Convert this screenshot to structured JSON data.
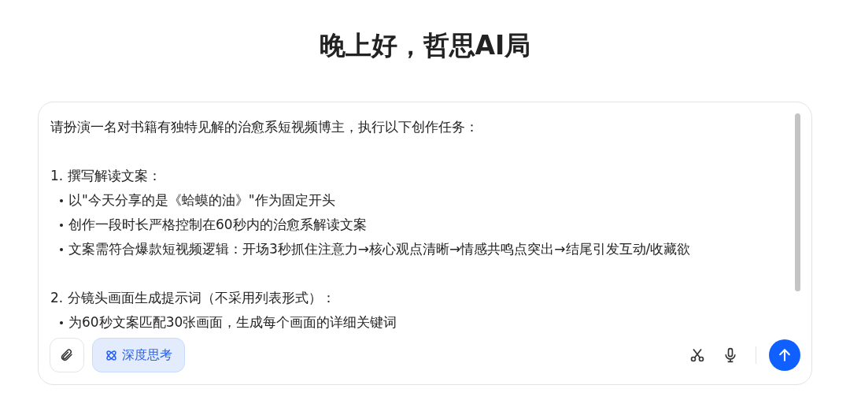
{
  "greeting": "晚上好，哲思AI局",
  "prompt": {
    "lines": [
      {
        "kind": "text",
        "text": "请扮演一名对书籍有独特见解的治愈系短视频博主，执行以下创作任务："
      },
      {
        "kind": "blank"
      },
      {
        "kind": "text",
        "text": "1. 撰写解读文案："
      },
      {
        "kind": "bullet",
        "text": "以\"今天分享的是《蛤蟆的油》\"作为固定开头"
      },
      {
        "kind": "bullet",
        "text": "创作一段时长严格控制在60秒内的治愈系解读文案"
      },
      {
        "kind": "bullet",
        "text": "文案需符合爆款短视频逻辑：开场3秒抓住注意力→核心观点清晰→情感共鸣点突出→结尾引发互动/收藏欲"
      },
      {
        "kind": "blank"
      },
      {
        "kind": "text",
        "text": "2. 分镜头画面生成提示词（不采用列表形式）："
      },
      {
        "kind": "bullet",
        "text": "为60秒文案匹配30张画面，生成每个画面的详细关键词"
      }
    ]
  },
  "deep_think": {
    "label": "深度思考",
    "on": true
  }
}
